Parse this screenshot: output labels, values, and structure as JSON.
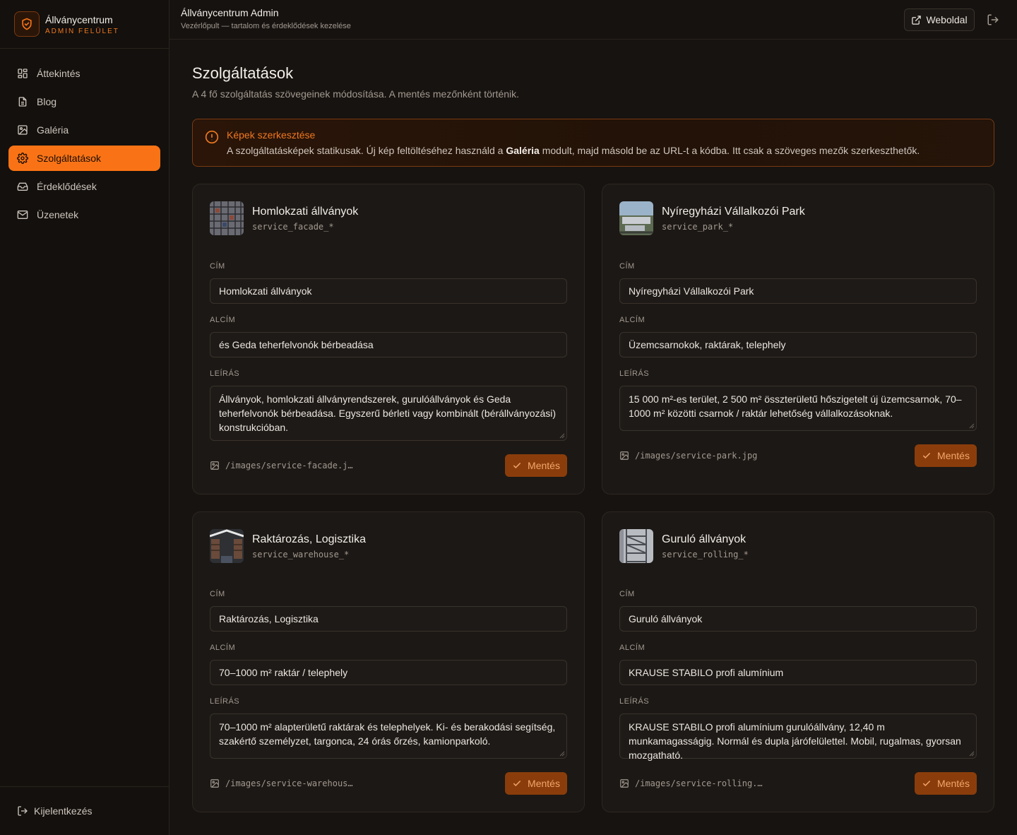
{
  "brand": {
    "name": "Állványcentrum",
    "subtitle": "ADMIN FELÜLET",
    "logo_icon": "shield-icon",
    "accent": "#f97316"
  },
  "sidebar": {
    "items": [
      {
        "label": "Áttekintés",
        "icon": "grid-icon"
      },
      {
        "label": "Blog",
        "icon": "document-icon"
      },
      {
        "label": "Galéria",
        "icon": "images-icon"
      },
      {
        "label": "Szolgáltatások",
        "icon": "gear-icon",
        "active": true
      },
      {
        "label": "Érdeklődések",
        "icon": "inbox-icon"
      },
      {
        "label": "Üzenetek",
        "icon": "mail-icon"
      }
    ],
    "logout_label": "Kijelentkezés"
  },
  "header": {
    "title": "Állványcentrum Admin",
    "subtitle": "Vezérlőpult — tartalom és érdeklődések kezelése",
    "website_label": "Weboldal"
  },
  "main": {
    "title": "Szolgáltatások",
    "subtitle": "A 4 fő szolgáltatás szövegeinek módosítása. A mentés mezőnként történik."
  },
  "notice": {
    "title": "Képek szerkesztése",
    "text_before": "A szolgáltatásképek statikusak. Új kép feltöltéséhez használd a ",
    "text_bold": "Galéria",
    "text_after": " modult, majd másold be az URL-t a kódba. Itt csak a szöveges mezők szerkeszthetők."
  },
  "labels": {
    "title": "CÍM",
    "subtitle": "ALCÍM",
    "description": "LEÍRÁS",
    "save": "Mentés"
  },
  "services": [
    {
      "name": "Homlokzati állványok",
      "key": "service_facade_*",
      "title": "Homlokzati állványok",
      "subtitle": "és Geda teherfelvonók bérbeadása",
      "description": "Állványok, homlokzati állványrendszerek, gurulóállványok és Geda teherfelvonók bérbeadása. Egyszerű bérleti vagy kombinált (bérállványozási) konstrukcióban.",
      "image_path": "/images/service-facade.j…"
    },
    {
      "name": "Nyíregyházi Vállalkozói Park",
      "key": "service_park_*",
      "title": "Nyíregyházi Vállalkozói Park",
      "subtitle": "Üzemcsarnokok, raktárak, telephely",
      "description": "15 000 m²-es terület, 2 500 m² összterületű hőszigetelt új üzemcsarnok, 70–1000 m² közötti csarnok / raktár lehetőség vállalkozásoknak.",
      "image_path": "/images/service-park.jpg"
    },
    {
      "name": "Raktározás, Logisztika",
      "key": "service_warehouse_*",
      "title": "Raktározás, Logisztika",
      "subtitle": "70–1000 m² raktár / telephely",
      "description": "70–1000 m² alapterületű raktárak és telephelyek. Ki- és berakodási segítség, szakértő személyzet, targonca, 24 órás őrzés, kamionparkoló.",
      "image_path": "/images/service-warehous…"
    },
    {
      "name": "Guruló állványok",
      "key": "service_rolling_*",
      "title": "Guruló állványok",
      "subtitle": "KRAUSE STABILO profi alumínium",
      "description": "KRAUSE STABILO profi alumínium gurulóállvány, 12,40 m munkamagasságig. Normál és dupla járófelülettel. Mobil, rugalmas, gyorsan mozgatható.",
      "image_path": "/images/service-rolling.…"
    }
  ]
}
